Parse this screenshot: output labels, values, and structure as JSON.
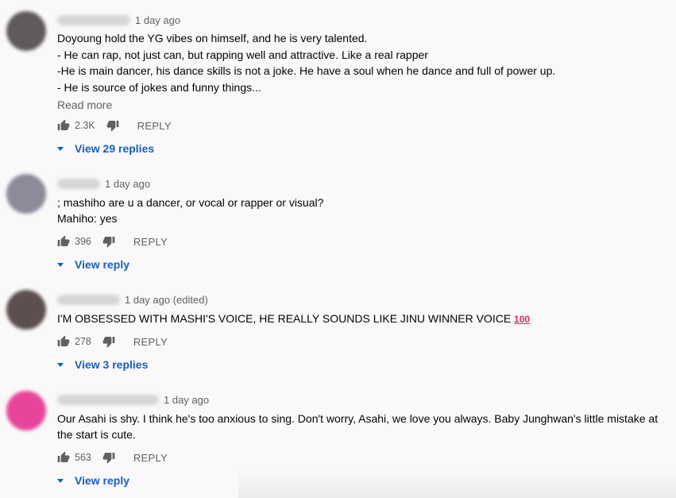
{
  "comments": [
    {
      "time": "1 day ago",
      "lines": [
        "Doyoung hold the YG vibes on himself, and he is very talented.",
        "- He can rap, not just can, but rapping well and attractive. Like a real rapper",
        "-He is main dancer, his dance skills is not a joke. He have a soul when he dance and full of power up.",
        "- He is source of jokes and funny things..."
      ],
      "read_more": "Read more",
      "likes": "2.3K",
      "reply_label": "REPLY",
      "replies_label": "View 29 replies",
      "avatar_color": "#5f5a5c"
    },
    {
      "time": "1 day ago",
      "lines": [
        "; mashiho are u a dancer, or vocal or rapper or visual?",
        "Mahiho: yes"
      ],
      "likes": "396",
      "reply_label": "REPLY",
      "replies_label": "View reply",
      "avatar_color": "#8d8a99"
    },
    {
      "time": "1 day ago (edited)",
      "lines": [
        "I'M OBSESSED WITH MASHI'S VOICE, HE REALLY SOUNDS LIKE JINU WINNER VOICE"
      ],
      "emoji": "100",
      "likes": "278",
      "reply_label": "REPLY",
      "replies_label": "View 3 replies",
      "avatar_color": "#5d4f4f"
    },
    {
      "time": "1 day ago",
      "lines": [
        "Our Asahi is shy. I think he's too anxious to sing. Don't worry, Asahi, we love you always. Baby Junghwan's little mistake at",
        "the start is cute."
      ],
      "likes": "563",
      "reply_label": "REPLY",
      "replies_label": "View reply",
      "avatar_color": "#e8459a"
    }
  ]
}
